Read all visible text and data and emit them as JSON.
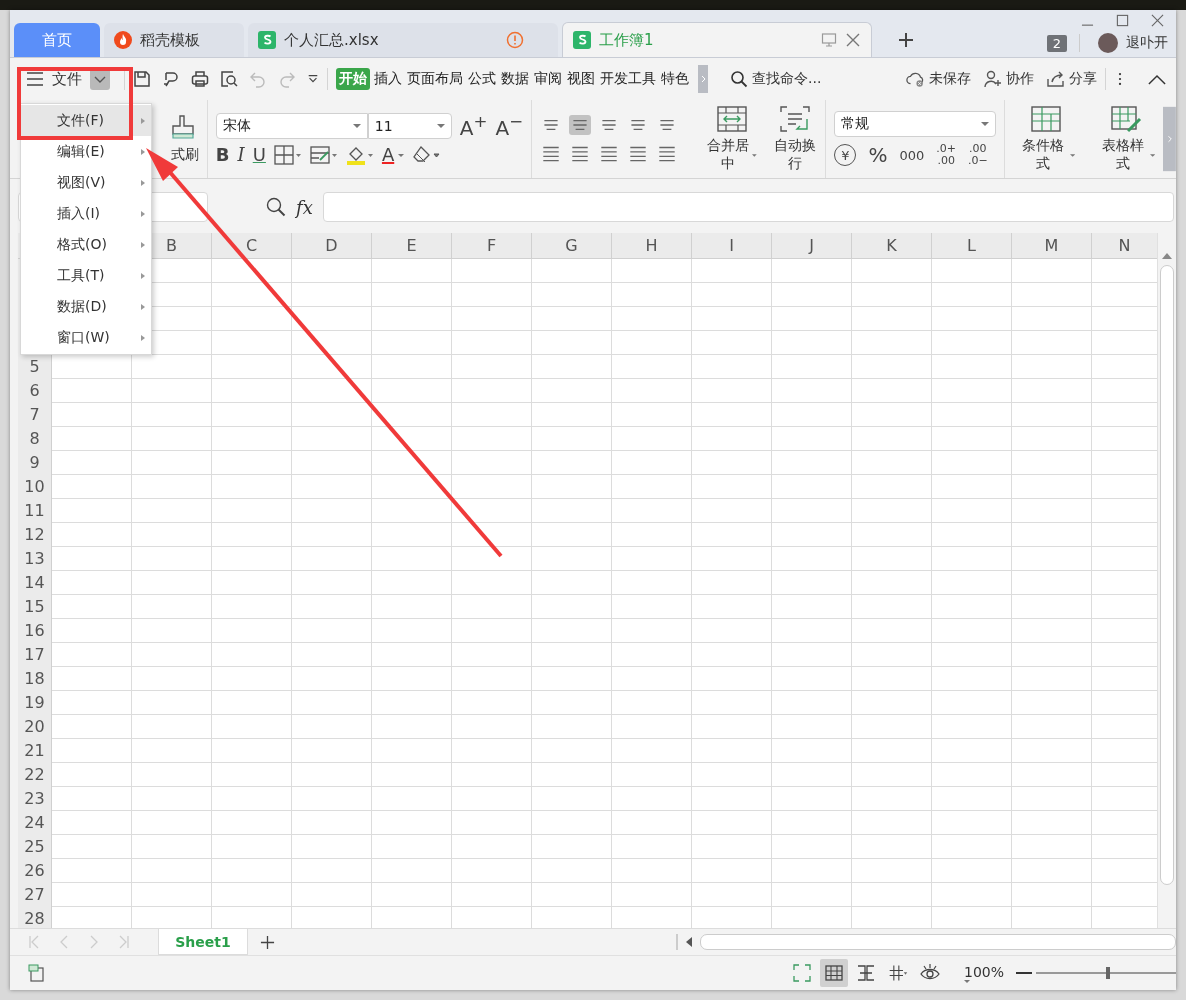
{
  "tabs": [
    {
      "label": "首页",
      "kind": "home",
      "selected": false,
      "warning": false
    },
    {
      "label": "稻壳模板",
      "kind": "docer",
      "selected": false,
      "warning": false
    },
    {
      "label": "个人汇总.xlsx",
      "kind": "sheet",
      "selected": false,
      "warning": true
    },
    {
      "label": "工作簿1",
      "kind": "sheet",
      "selected": true,
      "warning": false
    }
  ],
  "account": {
    "window_count": "2",
    "user": "退卟开"
  },
  "toolbar": {
    "menu_label": "文件",
    "ribbon_tabs": [
      {
        "label": "开始",
        "selected": true
      },
      {
        "label": "插入",
        "selected": false
      },
      {
        "label": "页面布局",
        "selected": false
      },
      {
        "label": "公式",
        "selected": false
      },
      {
        "label": "数据",
        "selected": false
      },
      {
        "label": "审阅",
        "selected": false
      },
      {
        "label": "视图",
        "selected": false
      },
      {
        "label": "开发工具",
        "selected": false
      },
      {
        "label": "特色",
        "selected": false
      }
    ],
    "search_placeholder": "查找命令...",
    "actions": [
      {
        "kind": "cloud",
        "label": "未保存"
      },
      {
        "kind": "collab",
        "label": "协作"
      },
      {
        "kind": "share",
        "label": "分享"
      }
    ]
  },
  "ribbon": {
    "format_painter": "式刷",
    "font": "宋体",
    "font_size": "11",
    "bold": "B",
    "italic": "I",
    "underline": "U",
    "font_color": "A",
    "grow_font": "A$^{+}$",
    "shrink_font": "A$^{−}$",
    "merge": "合并居中",
    "wrap": "自动换行",
    "number_format": "常规",
    "currency": "¥",
    "percent": "%",
    "thousands": "000",
    "decimals": [
      {
        "top": ".0+",
        "bottom": ".00"
      },
      {
        "top": ".00",
        "bottom": ".0−"
      }
    ],
    "conditional": "条件格式",
    "table_style": "表格样式"
  },
  "formula_bar": {
    "function_label": "fx"
  },
  "menu": {
    "items": [
      {
        "label": "文件(F)",
        "selected": true
      },
      {
        "label": "编辑(E)",
        "selected": false
      },
      {
        "label": "视图(V)",
        "selected": false
      },
      {
        "label": "插入(I)",
        "selected": false
      },
      {
        "label": "格式(O)",
        "selected": false
      },
      {
        "label": "工具(T)",
        "selected": false
      },
      {
        "label": "数据(D)",
        "selected": false
      },
      {
        "label": "窗口(W)",
        "selected": false
      }
    ]
  },
  "grid": {
    "columns": [
      "B",
      "C",
      "D",
      "E",
      "F",
      "G",
      "H",
      "I",
      "J",
      "K",
      "L",
      "M",
      "N"
    ],
    "rows": [
      "5",
      "6",
      "7",
      "8",
      "9",
      "10",
      "11",
      "12",
      "13",
      "14",
      "15",
      "16",
      "17",
      "18",
      "19",
      "20",
      "21",
      "22",
      "23",
      "24",
      "25",
      "26",
      "27",
      "28"
    ]
  },
  "sheets": [
    {
      "label": "Sheet1",
      "selected": true
    }
  ],
  "status_bar": {
    "zoom": "100%",
    "zoom_slider": {
      "level": 0.5
    }
  }
}
